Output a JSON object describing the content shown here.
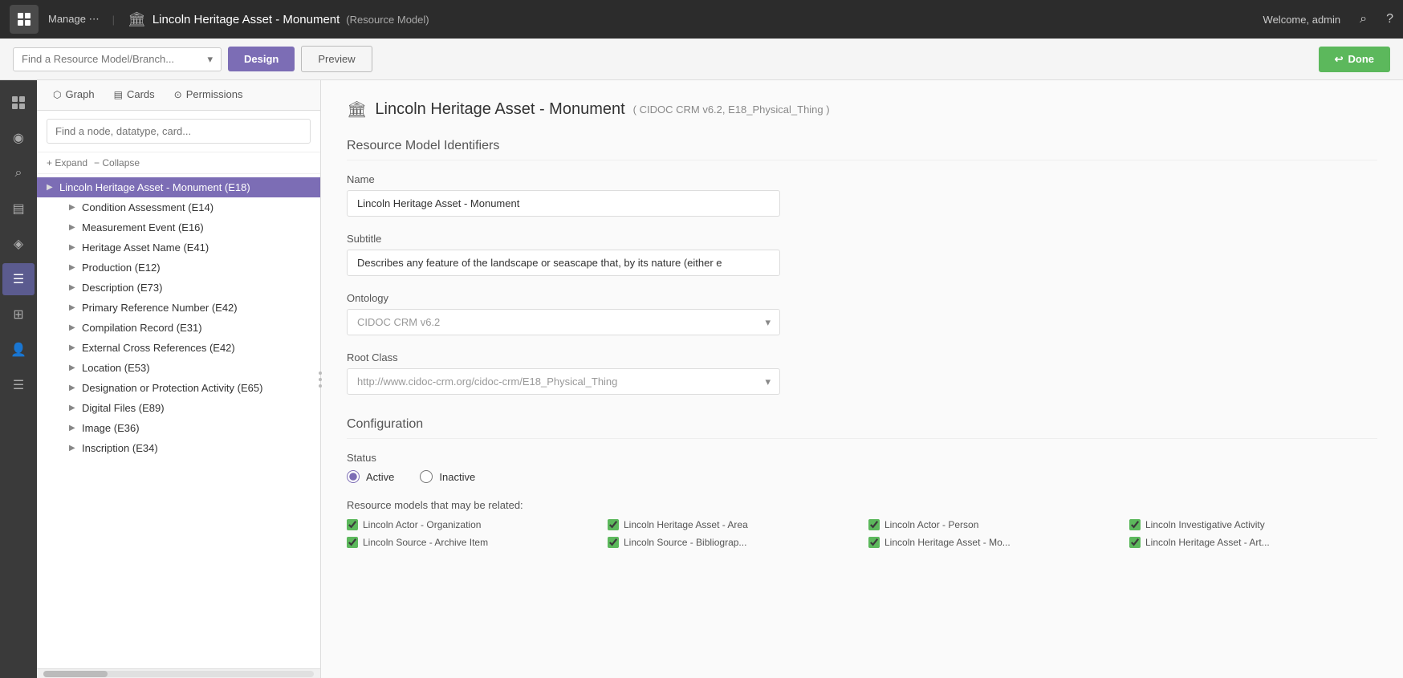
{
  "topNav": {
    "manage": "Manage ⋯",
    "pageTitle": "Lincoln Heritage Asset - Monument",
    "resourceModelTag": "(Resource Model)",
    "welcome": "Welcome, admin"
  },
  "subToolbar": {
    "searchPlaceholder": "Find a Resource Model/Branch...",
    "designLabel": "Design",
    "previewLabel": "Preview",
    "doneLabel": "Done"
  },
  "leftNav": {
    "items": [
      {
        "icon": "⊞",
        "label": "dashboard-nav"
      },
      {
        "icon": "◉",
        "label": "active-nav"
      },
      {
        "icon": "⌕",
        "label": "search-nav"
      },
      {
        "icon": "▤",
        "label": "list-nav"
      },
      {
        "icon": "◈",
        "label": "resources-nav"
      },
      {
        "icon": "☰",
        "label": "menu-nav"
      },
      {
        "icon": "⊞",
        "label": "grid-nav"
      },
      {
        "icon": "◈",
        "label": "graph-nav"
      },
      {
        "icon": "◉",
        "label": "settings-nav"
      }
    ],
    "activeIndex": 5
  },
  "panelTabs": [
    {
      "label": "Graph",
      "icon": "⬡",
      "active": false
    },
    {
      "label": "Cards",
      "icon": "▤",
      "active": false
    },
    {
      "label": "Permissions",
      "icon": "⊙",
      "active": false
    }
  ],
  "panelSearch": {
    "placeholder": "Find a node, datatype, card..."
  },
  "expandCollapse": {
    "expand": "+ Expand",
    "collapse": "− Collapse"
  },
  "treeNodes": {
    "root": "Lincoln Heritage Asset - Monument (E18)",
    "children": [
      "Condition Assessment (E14)",
      "Measurement Event (E16)",
      "Heritage Asset Name (E41)",
      "Production (E12)",
      "Description (E73)",
      "Primary Reference Number (E42)",
      "Compilation Record (E31)",
      "External Cross References (E42)",
      "Location (E53)",
      "Designation or Protection Activity (E65)",
      "Digital Files (E89)",
      "Image (E36)",
      "Inscription (E34)"
    ]
  },
  "mainContent": {
    "headerIcon": "🏛",
    "title": "Lincoln Heritage Asset - Monument",
    "ontologyTag": "( CIDOC CRM v6.2, E18_Physical_Thing )",
    "sections": {
      "identifiers": {
        "title": "Resource Model Identifiers",
        "nameLabel": "Name",
        "nameValue": "Lincoln Heritage Asset - Monument",
        "subtitleLabel": "Subtitle",
        "subtitleValue": "Describes any feature of the landscape or seascape that, by its nature (either e",
        "ontologyLabel": "Ontology",
        "ontologyValue": "CIDOC CRM v6.2",
        "rootClassLabel": "Root Class",
        "rootClassValue": "http://www.cidoc-crm.org/cidoc-crm/E18_Physical_Thing"
      },
      "configuration": {
        "title": "Configuration",
        "statusLabel": "Status",
        "activeLabel": "Active",
        "inactiveLabel": "Inactive",
        "relatedModelsTitle": "Resource models that may be related:",
        "relatedModels": [
          {
            "label": "Lincoln Actor - Organization",
            "checked": true
          },
          {
            "label": "Lincoln Heritage Asset - Area",
            "checked": true
          },
          {
            "label": "Lincoln Actor - Person",
            "checked": true
          },
          {
            "label": "Lincoln Investigative Activity",
            "checked": true
          },
          {
            "label": "Lincoln Source - Archive Item",
            "checked": true
          },
          {
            "label": "Lincoln Source - Bibliograp...",
            "checked": true
          },
          {
            "label": "Lincoln Heritage Asset - Mo...",
            "checked": true
          },
          {
            "label": "Lincoln Heritage Asset - Art...",
            "checked": true
          }
        ]
      }
    }
  }
}
